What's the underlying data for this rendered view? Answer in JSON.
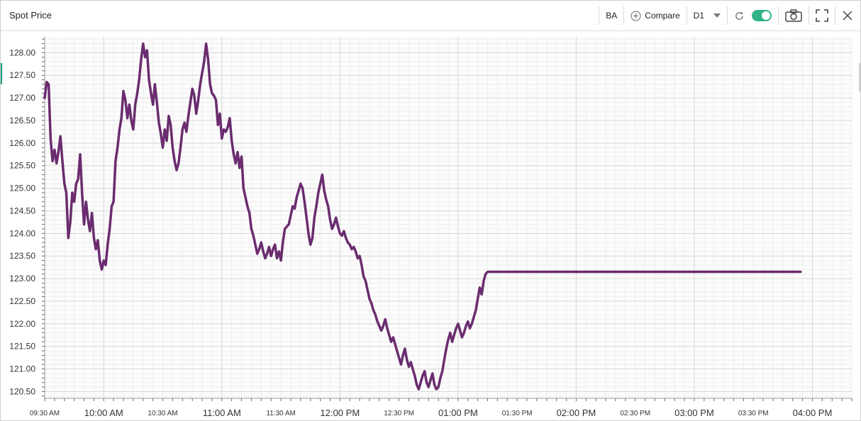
{
  "header": {
    "title": "Spot Price",
    "symbol": "BA",
    "compare_label": "Compare",
    "timeframe": "D1",
    "toggle_on": true
  },
  "colors": {
    "line": "#6a2c6f",
    "accent": "#2fb387",
    "grid_major": "#d7d7d7",
    "grid_minor": "#eeeeee"
  },
  "chart_data": {
    "type": "line",
    "title": "Spot Price",
    "symbol": "BA",
    "ylim": [
      120.35,
      128.35
    ],
    "y_major_ticks": [
      "120.50",
      "121.00",
      "121.50",
      "122.00",
      "122.50",
      "123.00",
      "123.50",
      "124.00",
      "124.50",
      "125.00",
      "125.50",
      "126.00",
      "126.50",
      "127.00",
      "127.50",
      "128.00"
    ],
    "x_time_range_minutes": [
      570,
      980
    ],
    "x_tick_labels": [
      {
        "t": 570,
        "label": "09:30 AM",
        "major": false
      },
      {
        "t": 600,
        "label": "10:00 AM",
        "major": true
      },
      {
        "t": 630,
        "label": "10:30 AM",
        "major": false
      },
      {
        "t": 660,
        "label": "11:00 AM",
        "major": true
      },
      {
        "t": 690,
        "label": "11:30 AM",
        "major": false
      },
      {
        "t": 720,
        "label": "12:00 PM",
        "major": true
      },
      {
        "t": 750,
        "label": "12:30 PM",
        "major": false
      },
      {
        "t": 780,
        "label": "01:00 PM",
        "major": true
      },
      {
        "t": 810,
        "label": "01:30 PM",
        "major": false
      },
      {
        "t": 840,
        "label": "02:00 PM",
        "major": true
      },
      {
        "t": 870,
        "label": "02:30 PM",
        "major": false
      },
      {
        "t": 900,
        "label": "03:00 PM",
        "major": true
      },
      {
        "t": 930,
        "label": "03:30 PM",
        "major": false
      },
      {
        "t": 960,
        "label": "04:00 PM",
        "major": true
      }
    ],
    "grid": true,
    "series": [
      {
        "name": "BA",
        "x_minutes": [
          570,
          571,
          572,
          573,
          574,
          575,
          576,
          577,
          578,
          579,
          580,
          581,
          582,
          583,
          584,
          585,
          586,
          587,
          588,
          589,
          590,
          591,
          592,
          593,
          594,
          595,
          596,
          597,
          598,
          599,
          600,
          601,
          602,
          603,
          604,
          605,
          606,
          607,
          608,
          609,
          610,
          611,
          612,
          613,
          614,
          615,
          616,
          617,
          618,
          619,
          620,
          621,
          622,
          623,
          624,
          625,
          626,
          627,
          628,
          629,
          630,
          631,
          632,
          633,
          634,
          635,
          636,
          637,
          638,
          639,
          640,
          641,
          642,
          643,
          644,
          645,
          646,
          647,
          648,
          649,
          650,
          651,
          652,
          653,
          654,
          655,
          656,
          657,
          658,
          659,
          660,
          661,
          662,
          663,
          664,
          665,
          666,
          667,
          668,
          669,
          670,
          671,
          672,
          673,
          674,
          675,
          676,
          677,
          678,
          679,
          680,
          681,
          682,
          683,
          684,
          685,
          686,
          687,
          688,
          689,
          690,
          691,
          692,
          693,
          694,
          695,
          696,
          697,
          698,
          699,
          700,
          701,
          702,
          703,
          704,
          705,
          706,
          707,
          708,
          709,
          710,
          711,
          712,
          713,
          714,
          715,
          716,
          717,
          718,
          719,
          720,
          721,
          722,
          723,
          724,
          725,
          726,
          727,
          728,
          729,
          730,
          731,
          732,
          733,
          734,
          735,
          736,
          737,
          738,
          739,
          740,
          741,
          742,
          743,
          744,
          745,
          746,
          747,
          748,
          749,
          750,
          751,
          752,
          753,
          754,
          755,
          756,
          757,
          758,
          759,
          760,
          761,
          762,
          763,
          764,
          765,
          766,
          767,
          768,
          769,
          770,
          771,
          772,
          773,
          774,
          775,
          776,
          777,
          778,
          779,
          780,
          781,
          782,
          783,
          784,
          785,
          786,
          787,
          788,
          789,
          790,
          791,
          792,
          793,
          794,
          795,
          796,
          797,
          798,
          799,
          800,
          801,
          802,
          803,
          804,
          805,
          806,
          807,
          808,
          809,
          810,
          811,
          812,
          813,
          814,
          815,
          816,
          817,
          818,
          819,
          820,
          821,
          822,
          823,
          824,
          825,
          826,
          827,
          828,
          829,
          830,
          831,
          832,
          833,
          834,
          835,
          836,
          837,
          838,
          839,
          840,
          841,
          842,
          843,
          844,
          845,
          846,
          847,
          848,
          849,
          850,
          851,
          852,
          853,
          854,
          855,
          856,
          857,
          858,
          859,
          860,
          861,
          862,
          863,
          864,
          865,
          866,
          867,
          868,
          869,
          870,
          871,
          872,
          873,
          874,
          875,
          876,
          877,
          878,
          879,
          880,
          881,
          882,
          883,
          884,
          885,
          886,
          887,
          888,
          889,
          890,
          891,
          892,
          893,
          894,
          895,
          896,
          897,
          898,
          899,
          900,
          901,
          902,
          903,
          904,
          905,
          906,
          907,
          908,
          909,
          910,
          911,
          912,
          913,
          914,
          915,
          916,
          917,
          918,
          919,
          920,
          921,
          922,
          923,
          924,
          925,
          926,
          927,
          928,
          929,
          930,
          931,
          932,
          933,
          934,
          935,
          936,
          937,
          938,
          939,
          940,
          941,
          942,
          943,
          944,
          945,
          946,
          947,
          948,
          949,
          950,
          951,
          952,
          953,
          954,
          955,
          956,
          957,
          958,
          959,
          960,
          961,
          962,
          963,
          964,
          965,
          966,
          967,
          968,
          969,
          970,
          971,
          972,
          973,
          974,
          975,
          976,
          977,
          978,
          979,
          980
        ],
        "values": [
          127.0,
          127.35,
          127.3,
          126.1,
          125.6,
          125.85,
          125.55,
          125.8,
          126.15,
          125.6,
          125.1,
          124.9,
          123.9,
          124.25,
          124.9,
          124.7,
          125.1,
          125.2,
          125.75,
          124.9,
          124.2,
          124.7,
          124.3,
          124.05,
          124.45,
          123.9,
          123.65,
          123.85,
          123.4,
          123.2,
          123.4,
          123.3,
          123.75,
          124.1,
          124.6,
          124.7,
          125.6,
          125.9,
          126.3,
          126.55,
          127.15,
          126.95,
          126.55,
          126.85,
          126.5,
          126.3,
          126.85,
          127.1,
          127.4,
          127.85,
          128.2,
          127.9,
          128.05,
          127.4,
          127.1,
          126.85,
          127.3,
          126.9,
          126.45,
          126.2,
          125.9,
          126.3,
          126.05,
          126.6,
          126.4,
          125.9,
          125.6,
          125.4,
          125.55,
          125.9,
          126.3,
          126.45,
          126.25,
          126.6,
          126.9,
          127.2,
          127.05,
          126.65,
          126.95,
          127.3,
          127.55,
          127.8,
          128.2,
          127.85,
          127.3,
          127.1,
          127.05,
          126.95,
          126.4,
          126.65,
          126.1,
          126.3,
          126.25,
          126.35,
          126.55,
          126.05,
          125.75,
          125.55,
          125.8,
          125.45,
          125.7,
          125.0,
          124.8,
          124.6,
          124.45,
          124.1,
          123.95,
          123.75,
          123.55,
          123.65,
          123.8,
          123.6,
          123.45,
          123.55,
          123.7,
          123.5,
          123.65,
          123.75,
          123.45,
          123.6,
          123.4,
          123.8,
          124.1,
          124.15,
          124.2,
          124.4,
          124.6,
          124.55,
          124.8,
          124.95,
          125.1,
          125.0,
          124.7,
          124.35,
          124.0,
          123.75,
          123.9,
          124.35,
          124.6,
          124.9,
          125.1,
          125.3,
          124.95,
          124.75,
          124.6,
          124.3,
          124.1,
          124.2,
          124.35,
          124.15,
          124.0,
          123.95,
          124.05,
          123.9,
          123.8,
          123.75,
          123.65,
          123.7,
          123.6,
          123.45,
          123.5,
          123.3,
          123.05,
          122.95,
          122.75,
          122.55,
          122.45,
          122.3,
          122.2,
          122.05,
          121.95,
          121.85,
          121.95,
          122.1,
          121.9,
          121.75,
          121.6,
          121.7,
          121.55,
          121.4,
          121.25,
          121.1,
          121.3,
          121.45,
          121.2,
          121.05,
          121.15,
          121.0,
          120.85,
          120.65,
          120.55,
          120.7,
          120.85,
          120.95,
          120.7,
          120.6,
          120.75,
          120.9,
          120.65,
          120.55,
          120.6,
          120.8,
          120.95,
          121.2,
          121.45,
          121.65,
          121.8,
          121.6,
          121.75,
          121.9,
          122.0,
          121.85,
          121.7,
          121.8,
          121.95,
          122.05,
          121.9,
          122.0,
          122.15,
          122.3,
          122.55,
          122.8,
          122.65,
          122.95,
          123.1,
          123.15,
          123.15,
          123.15,
          123.15,
          123.15,
          123.15,
          123.15,
          123.15,
          123.15,
          123.15,
          123.15,
          123.15,
          123.15,
          123.15,
          123.15,
          123.15,
          123.15,
          123.15,
          123.15,
          123.15,
          123.15,
          123.15,
          123.15,
          123.15,
          123.15,
          123.15,
          123.15,
          123.15,
          123.15,
          123.15,
          123.15,
          123.15,
          123.15,
          123.15,
          123.15,
          123.15,
          123.15,
          123.15,
          123.15,
          123.15,
          123.15,
          123.15,
          123.15,
          123.15,
          123.15,
          123.15,
          123.15,
          123.15,
          123.15,
          123.15,
          123.15,
          123.15,
          123.15,
          123.15,
          123.15,
          123.15,
          123.15,
          123.15,
          123.15,
          123.15,
          123.15,
          123.15,
          123.15,
          123.15,
          123.15,
          123.15,
          123.15,
          123.15,
          123.15,
          123.15,
          123.15,
          123.15,
          123.15,
          123.15,
          123.15,
          123.15,
          123.15,
          123.15,
          123.15,
          123.15,
          123.15,
          123.15,
          123.15,
          123.15,
          123.15,
          123.15,
          123.15,
          123.15,
          123.15,
          123.15,
          123.15,
          123.15,
          123.15,
          123.15,
          123.15,
          123.15,
          123.15,
          123.15,
          123.15,
          123.15,
          123.15,
          123.15,
          123.15,
          123.15,
          123.15,
          123.15,
          123.15,
          123.15,
          123.15,
          123.15,
          123.15,
          123.15,
          123.15,
          123.15,
          123.15,
          123.15,
          123.15,
          123.15,
          123.15,
          123.15,
          123.15,
          123.15,
          123.15,
          123.15,
          123.15,
          123.15,
          123.15,
          123.15,
          123.15,
          123.15,
          123.15,
          123.15,
          123.15,
          123.15,
          123.15,
          123.15,
          123.15,
          123.15,
          123.15,
          123.15,
          123.15,
          123.15,
          123.15,
          123.15,
          123.15,
          123.15,
          123.15,
          123.15,
          123.15,
          123.15,
          123.15,
          123.15,
          123.15,
          123.15,
          123.15,
          123.15,
          123.15,
          123.15,
          123.15,
          123.15
        ]
      }
    ]
  }
}
